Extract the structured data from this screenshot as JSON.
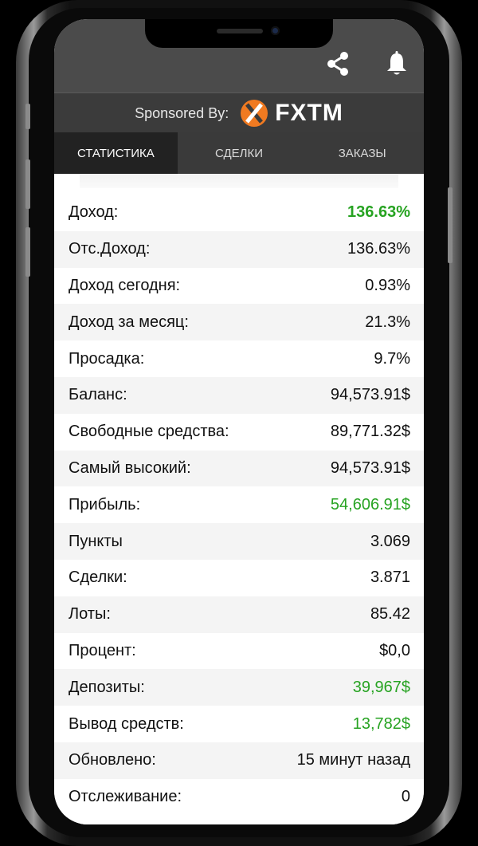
{
  "header": {
    "sponsor_label": "Sponsored By:",
    "sponsor_brand": "FXTM",
    "icons": [
      "share-icon",
      "bell-icon"
    ]
  },
  "tabs": [
    {
      "label": "СТАТИСТИКА",
      "active": true
    },
    {
      "label": "СДЕЛКИ",
      "active": false
    },
    {
      "label": "ЗАКАЗЫ",
      "active": false
    }
  ],
  "stats": [
    {
      "label": "Доход:",
      "value": "136.63%"
    },
    {
      "label": "Отс.Доход:",
      "value": "136.63%"
    },
    {
      "label": "Доход сегодня:",
      "value": "0.93%"
    },
    {
      "label": "Доход за месяц:",
      "value": "21.3%"
    },
    {
      "label": "Просадка:",
      "value": "9.7%"
    },
    {
      "label": "Баланс:",
      "value": "94,573.91$"
    },
    {
      "label": "Свободные средства:",
      "value": "89,771.32$"
    },
    {
      "label": "Самый высокий:",
      "value": "94,573.91$"
    },
    {
      "label": "Прибыль:",
      "value": "54,606.91$"
    },
    {
      "label": "Пункты",
      "value": "3.069"
    },
    {
      "label": "Сделки:",
      "value": "3.871"
    },
    {
      "label": "Лоты:",
      "value": "85.42"
    },
    {
      "label": "Процент:",
      "value": "$0,0"
    },
    {
      "label": "Депозиты:",
      "value": "39,967$"
    },
    {
      "label": "Вывод средств:",
      "value": "13,782$"
    },
    {
      "label": "Обновлено:",
      "value": "15 минут назад"
    },
    {
      "label": "Отслеживание:",
      "value": "0"
    }
  ],
  "colors": {
    "positive": "#27a322",
    "brand_orange": "#f07a21",
    "header_bg": "#4b4b4b",
    "tab_active_bg": "#222222"
  }
}
